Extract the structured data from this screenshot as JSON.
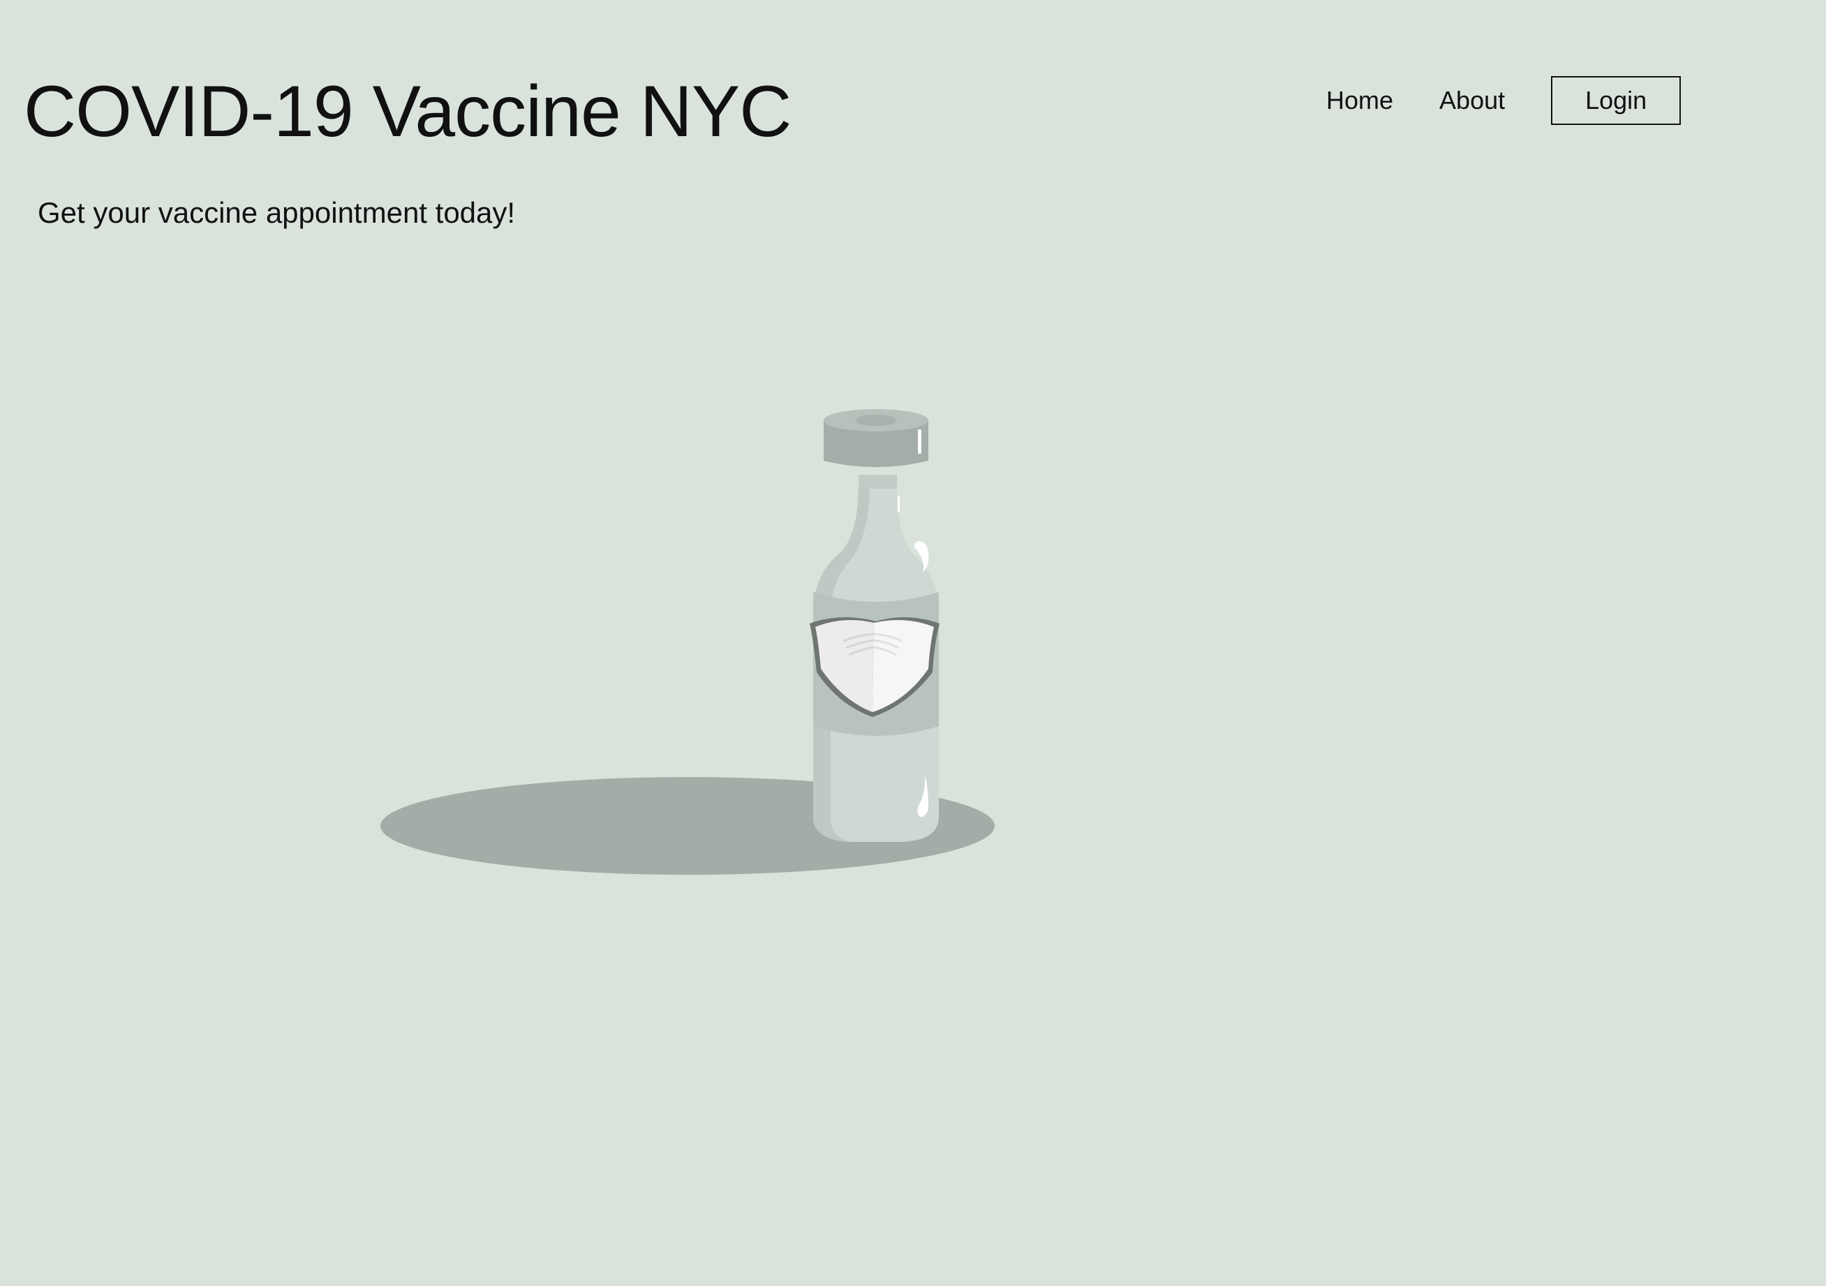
{
  "header": {
    "title": "COVID-19 Vaccine NYC",
    "tagline": "Get your vaccine appointment today!"
  },
  "nav": {
    "home_label": "Home",
    "about_label": "About",
    "login_label": "Login"
  },
  "hero": {
    "illustration": "vaccine-vial-with-mask-illustration"
  },
  "colors": {
    "background": "#d9e3dc",
    "shadow": "#a3aca6",
    "vial_glass": "#cfd8d2",
    "vial_cap": "#a4ada8",
    "mask": "#f2f2f2",
    "text": "#111111"
  }
}
